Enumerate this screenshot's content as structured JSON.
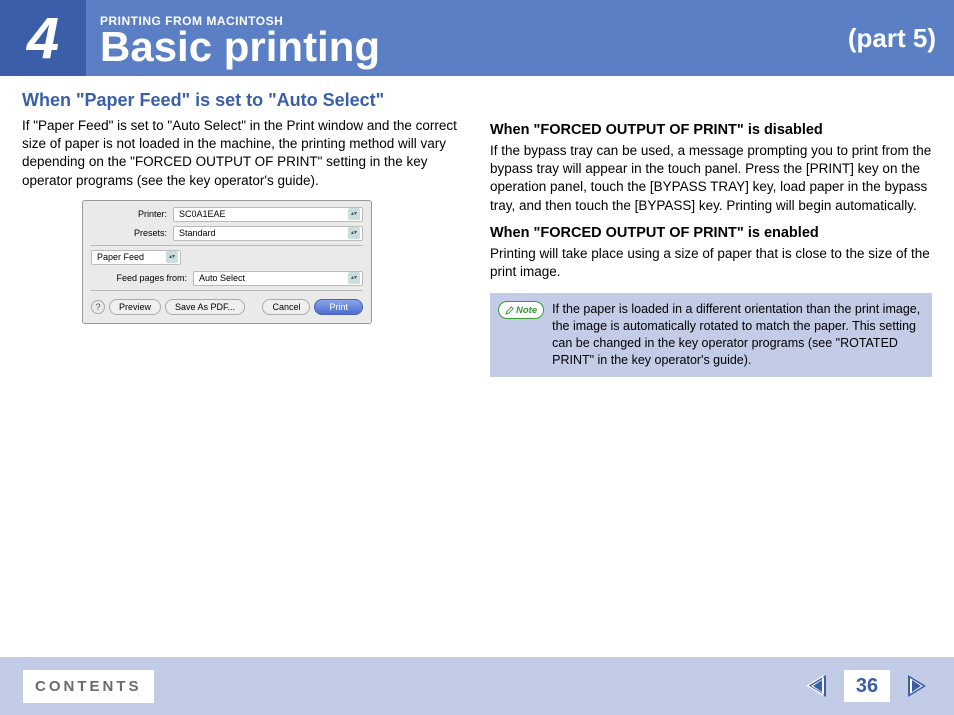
{
  "header": {
    "chapter_number": "4",
    "breadcrumb": "PRINTING FROM MACINTOSH",
    "title": "Basic printing",
    "part": "(part 5)"
  },
  "left": {
    "section_title": "When \"Paper Feed\" is set to \"Auto Select\"",
    "intro": "If \"Paper Feed\" is set to \"Auto Select\" in the Print window and the correct size of paper is not loaded in the machine, the printing method will vary depending on the \"FORCED OUTPUT OF PRINT\" setting in the key operator programs (see the key operator's guide)."
  },
  "dialog": {
    "printer_label": "Printer:",
    "printer_value": "SC0A1EAE",
    "presets_label": "Presets:",
    "presets_value": "Standard",
    "section_value": "Paper Feed",
    "feed_label": "Feed pages from:",
    "feed_value": "Auto Select",
    "help": "?",
    "preview": "Preview",
    "save_pdf": "Save As PDF...",
    "cancel": "Cancel",
    "print": "Print"
  },
  "right": {
    "h1": "When \"FORCED OUTPUT OF PRINT\" is disabled",
    "p1": "If the bypass tray can be used, a message prompting you to print from the bypass tray will appear in the touch panel. Press the [PRINT] key on the operation panel, touch the [BYPASS TRAY] key, load paper in the bypass tray, and then touch the [BYPASS] key. Printing will begin automatically.",
    "h2": "When \"FORCED OUTPUT OF PRINT\" is enabled",
    "p2": "Printing will take place using a size of paper that is close to the size of the print image.",
    "note_label": "Note",
    "note_text": "If the paper is loaded in a different orientation than the print image, the image is automatically rotated to match the paper. This setting can be changed in the key operator programs (see \"ROTATED PRINT\" in the key operator's guide)."
  },
  "footer": {
    "contents": "CONTENTS",
    "page": "36"
  }
}
